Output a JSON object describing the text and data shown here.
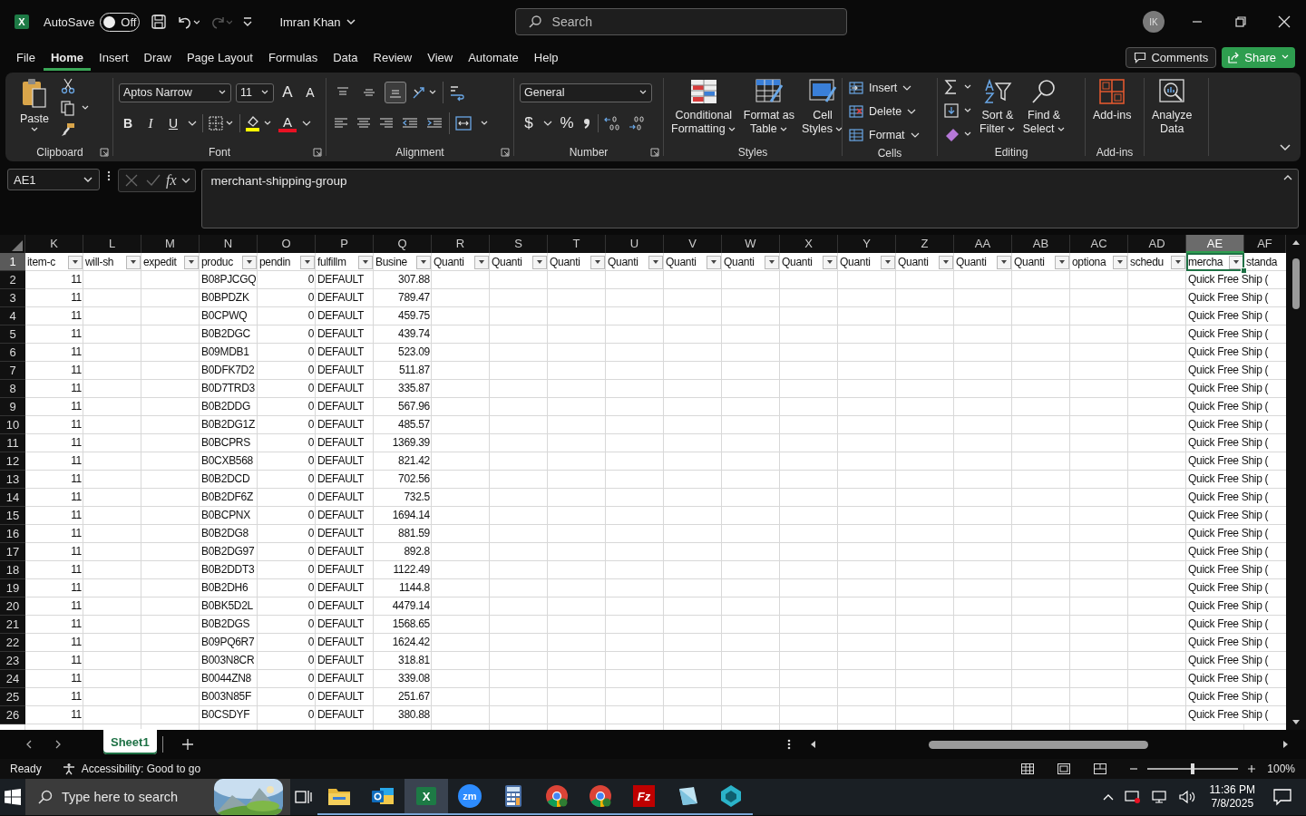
{
  "title_bar": {
    "logo": "X",
    "autosave_label": "AutoSave",
    "autosave": {
      "on": false,
      "label": "Off"
    },
    "account": "Imran Khan",
    "search_placeholder": "Search",
    "avatar": "IK"
  },
  "menu_tabs": [
    {
      "label": "File",
      "selected": false
    },
    {
      "label": "Home",
      "selected": true
    },
    {
      "label": "Insert",
      "selected": false
    },
    {
      "label": "Draw",
      "selected": false
    },
    {
      "label": "Page Layout",
      "selected": false
    },
    {
      "label": "Formulas",
      "selected": false
    },
    {
      "label": "Data",
      "selected": false
    },
    {
      "label": "Review",
      "selected": false
    },
    {
      "label": "View",
      "selected": false
    },
    {
      "label": "Automate",
      "selected": false
    },
    {
      "label": "Help",
      "selected": false
    }
  ],
  "comments": "Comments",
  "share": "Share",
  "ribbon": {
    "paste": "Paste",
    "font": {
      "name": "Aptos Narrow",
      "size": "11",
      "grow": "A",
      "shrink": "A",
      "bold": "B",
      "italic": "I",
      "underline": "U",
      "text_color_letter": "A"
    },
    "vertical_align": [
      {
        "kind": "top",
        "selected": false
      },
      {
        "kind": "middle",
        "selected": false
      },
      {
        "kind": "bottom",
        "selected": true
      }
    ],
    "number": {
      "format": "General",
      "currency": "$",
      "percent": "%"
    },
    "styles": [
      {
        "kind": "conditional",
        "lines": [
          "Conditional",
          "Formatting"
        ]
      },
      {
        "kind": "table",
        "lines": [
          "Format as",
          "Table"
        ]
      },
      {
        "kind": "cell",
        "lines": [
          "Cell",
          "Styles"
        ]
      }
    ],
    "cells": [
      {
        "kind": "insert",
        "label": "Insert"
      },
      {
        "kind": "delete",
        "label": "Delete"
      },
      {
        "kind": "format",
        "label": "Format"
      }
    ],
    "editing": [
      {
        "kind": "sort",
        "lines": [
          "Sort &",
          "Filter"
        ]
      },
      {
        "kind": "find",
        "lines": [
          "Find &",
          "Select"
        ]
      }
    ],
    "addins": [
      "Add-ins"
    ],
    "analyze": [
      "Analyze",
      "Data"
    ],
    "groups": [
      {
        "kind": "clipboard",
        "label": "Clipboard",
        "launcher": true
      },
      {
        "kind": "font",
        "label": "Font",
        "launcher": true
      },
      {
        "kind": "alignment",
        "label": "Alignment",
        "launcher": true
      },
      {
        "kind": "number",
        "label": "Number",
        "launcher": true
      },
      {
        "kind": "styles",
        "label": "Styles",
        "launcher": false
      },
      {
        "kind": "cells",
        "label": "Cells",
        "launcher": false
      },
      {
        "kind": "editing",
        "label": "Editing",
        "launcher": false
      },
      {
        "kind": "addins",
        "label": "Add-ins",
        "launcher": false
      },
      {
        "kind": "analyze"
      }
    ]
  },
  "formula_bar": {
    "name_box": "AE1",
    "fx": "fx",
    "formula": "merchant-shipping-group"
  },
  "sheet": {
    "columns": [
      {
        "letter": "K",
        "selected": false,
        "numeric": true
      },
      {
        "letter": "L",
        "selected": false
      },
      {
        "letter": "M",
        "selected": false
      },
      {
        "letter": "N",
        "selected": false,
        "numeric": false
      },
      {
        "letter": "O",
        "selected": false,
        "numeric": true
      },
      {
        "letter": "P",
        "selected": false,
        "numeric": false
      },
      {
        "letter": "Q",
        "selected": false,
        "numeric": true
      },
      {
        "letter": "R",
        "selected": false
      },
      {
        "letter": "S",
        "selected": false
      },
      {
        "letter": "T",
        "selected": false
      },
      {
        "letter": "U",
        "selected": false
      },
      {
        "letter": "V",
        "selected": false
      },
      {
        "letter": "W",
        "selected": false
      },
      {
        "letter": "X",
        "selected": false
      },
      {
        "letter": "Y",
        "selected": false
      },
      {
        "letter": "Z",
        "selected": false
      },
      {
        "letter": "AA",
        "selected": false
      },
      {
        "letter": "AB",
        "selected": false
      },
      {
        "letter": "AC",
        "selected": false
      },
      {
        "letter": "AD",
        "selected": false
      },
      {
        "letter": "AE",
        "selected": true,
        "numeric": false
      },
      {
        "letter": "AF",
        "selected": false
      }
    ],
    "rows": [
      {
        "number": "1",
        "kind": "header",
        "selected": true,
        "cells": {
          "K": "item-c",
          "L": "will-sh",
          "M": "expedit",
          "N": "produc",
          "O": "pendin",
          "P": "fulfillm",
          "Q": "Busine",
          "R": "Quanti",
          "S": "Quanti",
          "T": "Quanti",
          "U": "Quanti",
          "V": "Quanti",
          "W": "Quanti",
          "X": "Quanti",
          "Y": "Quanti",
          "Z": "Quanti",
          "AA": "Quanti",
          "AB": "Quanti",
          "AC": "optiona",
          "AD": "schedu",
          "AE": "mercha",
          "AF": "standa"
        }
      },
      {
        "number": "2",
        "kind": "data",
        "selected": false,
        "cells": {
          "K": "11",
          "N": "B08PJCGQ",
          "O": "0",
          "P": "DEFAULT",
          "Q": "307.88",
          "AE": "Quick Free Ship ("
        }
      },
      {
        "number": "3",
        "kind": "data",
        "selected": false,
        "cells": {
          "K": "11",
          "N": "B0BPDZK",
          "O": "0",
          "P": "DEFAULT",
          "Q": "789.47",
          "AE": "Quick Free Ship ("
        }
      },
      {
        "number": "4",
        "kind": "data",
        "selected": false,
        "cells": {
          "K": "11",
          "N": "B0CPWQ",
          "O": "0",
          "P": "DEFAULT",
          "Q": "459.75",
          "AE": "Quick Free Ship ("
        }
      },
      {
        "number": "5",
        "kind": "data",
        "selected": false,
        "cells": {
          "K": "11",
          "N": "B0B2DGC",
          "O": "0",
          "P": "DEFAULT",
          "Q": "439.74",
          "AE": "Quick Free Ship ("
        }
      },
      {
        "number": "6",
        "kind": "data",
        "selected": false,
        "cells": {
          "K": "11",
          "N": "B09MDB1",
          "O": "0",
          "P": "DEFAULT",
          "Q": "523.09",
          "AE": "Quick Free Ship ("
        }
      },
      {
        "number": "7",
        "kind": "data",
        "selected": false,
        "cells": {
          "K": "11",
          "N": "B0DFK7D2",
          "O": "0",
          "P": "DEFAULT",
          "Q": "511.87",
          "AE": "Quick Free Ship ("
        }
      },
      {
        "number": "8",
        "kind": "data",
        "selected": false,
        "cells": {
          "K": "11",
          "N": "B0D7TRD3",
          "O": "0",
          "P": "DEFAULT",
          "Q": "335.87",
          "AE": "Quick Free Ship ("
        }
      },
      {
        "number": "9",
        "kind": "data",
        "selected": false,
        "cells": {
          "K": "11",
          "N": "B0B2DDG",
          "O": "0",
          "P": "DEFAULT",
          "Q": "567.96",
          "AE": "Quick Free Ship ("
        }
      },
      {
        "number": "10",
        "kind": "data",
        "selected": false,
        "cells": {
          "K": "11",
          "N": "B0B2DG1Z",
          "O": "0",
          "P": "DEFAULT",
          "Q": "485.57",
          "AE": "Quick Free Ship ("
        }
      },
      {
        "number": "11",
        "kind": "data",
        "selected": false,
        "cells": {
          "K": "11",
          "N": "B0BCPRS",
          "O": "0",
          "P": "DEFAULT",
          "Q": "1369.39",
          "AE": "Quick Free Ship ("
        }
      },
      {
        "number": "12",
        "kind": "data",
        "selected": false,
        "cells": {
          "K": "11",
          "N": "B0CXB568",
          "O": "0",
          "P": "DEFAULT",
          "Q": "821.42",
          "AE": "Quick Free Ship ("
        }
      },
      {
        "number": "13",
        "kind": "data",
        "selected": false,
        "cells": {
          "K": "11",
          "N": "B0B2DCD",
          "O": "0",
          "P": "DEFAULT",
          "Q": "702.56",
          "AE": "Quick Free Ship ("
        }
      },
      {
        "number": "14",
        "kind": "data",
        "selected": false,
        "cells": {
          "K": "11",
          "N": "B0B2DF6Z",
          "O": "0",
          "P": "DEFAULT",
          "Q": "732.5",
          "AE": "Quick Free Ship ("
        }
      },
      {
        "number": "15",
        "kind": "data",
        "selected": false,
        "cells": {
          "K": "11",
          "N": "B0BCPNX",
          "O": "0",
          "P": "DEFAULT",
          "Q": "1694.14",
          "AE": "Quick Free Ship ("
        }
      },
      {
        "number": "16",
        "kind": "data",
        "selected": false,
        "cells": {
          "K": "11",
          "N": "B0B2DG8",
          "O": "0",
          "P": "DEFAULT",
          "Q": "881.59",
          "AE": "Quick Free Ship ("
        }
      },
      {
        "number": "17",
        "kind": "data",
        "selected": false,
        "cells": {
          "K": "11",
          "N": "B0B2DG97",
          "O": "0",
          "P": "DEFAULT",
          "Q": "892.8",
          "AE": "Quick Free Ship ("
        }
      },
      {
        "number": "18",
        "kind": "data",
        "selected": false,
        "cells": {
          "K": "11",
          "N": "B0B2DDT3",
          "O": "0",
          "P": "DEFAULT",
          "Q": "1122.49",
          "AE": "Quick Free Ship ("
        }
      },
      {
        "number": "19",
        "kind": "data",
        "selected": false,
        "cells": {
          "K": "11",
          "N": "B0B2DH6",
          "O": "0",
          "P": "DEFAULT",
          "Q": "1144.8",
          "AE": "Quick Free Ship ("
        }
      },
      {
        "number": "20",
        "kind": "data",
        "selected": false,
        "cells": {
          "K": "11",
          "N": "B0BK5D2L",
          "O": "0",
          "P": "DEFAULT",
          "Q": "4479.14",
          "AE": "Quick Free Ship ("
        }
      },
      {
        "number": "21",
        "kind": "data",
        "selected": false,
        "cells": {
          "K": "11",
          "N": "B0B2DGS",
          "O": "0",
          "P": "DEFAULT",
          "Q": "1568.65",
          "AE": "Quick Free Ship ("
        }
      },
      {
        "number": "22",
        "kind": "data",
        "selected": false,
        "cells": {
          "K": "11",
          "N": "B09PQ6R7",
          "O": "0",
          "P": "DEFAULT",
          "Q": "1624.42",
          "AE": "Quick Free Ship ("
        }
      },
      {
        "number": "23",
        "kind": "data",
        "selected": false,
        "cells": {
          "K": "11",
          "N": "B003N8CR",
          "O": "0",
          "P": "DEFAULT",
          "Q": "318.81",
          "AE": "Quick Free Ship ("
        }
      },
      {
        "number": "24",
        "kind": "data",
        "selected": false,
        "cells": {
          "K": "11",
          "N": "B0044ZN8",
          "O": "0",
          "P": "DEFAULT",
          "Q": "339.08",
          "AE": "Quick Free Ship ("
        }
      },
      {
        "number": "25",
        "kind": "data",
        "selected": false,
        "cells": {
          "K": "11",
          "N": "B003N85F",
          "O": "0",
          "P": "DEFAULT",
          "Q": "251.67",
          "AE": "Quick Free Ship ("
        }
      },
      {
        "number": "26",
        "kind": "data",
        "selected": false,
        "cells": {
          "K": "11",
          "N": "B0CSDYF",
          "O": "0",
          "P": "DEFAULT",
          "Q": "380.88",
          "AE": "Quick Free Ship ("
        }
      }
    ],
    "sheet_tabs": [
      {
        "label": "Sheet1",
        "selected": true
      }
    ]
  },
  "status_bar": {
    "ready": "Ready",
    "accessibility": "Accessibility: Good to go",
    "zoom": {
      "level": 0.5,
      "label": "100%"
    }
  },
  "taskbar": {
    "search_placeholder": "Type here to search",
    "apps": [
      {
        "kind": "explorer",
        "selected": false
      },
      {
        "kind": "outlook",
        "selected": false
      },
      {
        "kind": "excel",
        "glyph": "X",
        "selected": true
      },
      {
        "kind": "zoom",
        "glyph": "zm",
        "selected": false
      },
      {
        "kind": "calculator",
        "selected": false
      },
      {
        "kind": "chrome",
        "selected": false
      },
      {
        "kind": "chrome",
        "selected": false
      },
      {
        "kind": "filezilla",
        "glyph": "Fz",
        "selected": false
      },
      {
        "kind": "notes",
        "selected": false
      },
      {
        "kind": "cube",
        "selected": false
      }
    ],
    "time": "11:36 PM",
    "date": "7/8/2025"
  }
}
